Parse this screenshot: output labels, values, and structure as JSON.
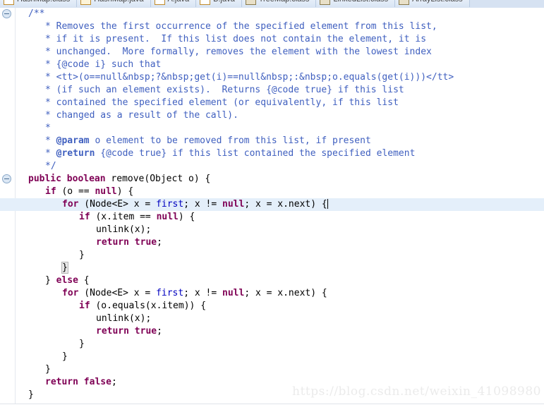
{
  "window": {
    "app": "Eclipse Java Editor",
    "watermark": "https://blog.csdn.net/weixin_41098980"
  },
  "tabbar": {
    "tabs": [
      {
        "label": "HashMap.class",
        "icon": "java-class-icon",
        "icon_kind": "doc",
        "active": false
      },
      {
        "label": "HashMap.java",
        "icon": "java-source-icon",
        "icon_kind": "docj",
        "active": false
      },
      {
        "label": "A.java",
        "icon": "java-source-icon",
        "icon_kind": "doc",
        "active": false
      },
      {
        "label": "B.java",
        "icon": "java-source-icon",
        "icon_kind": "doc",
        "active": false
      },
      {
        "label": "TreeMap.class",
        "icon": "java-jar-icon",
        "icon_kind": "jar",
        "active": false
      },
      {
        "label": "LinkedList.class",
        "icon": "java-jar-icon",
        "icon_kind": "jar",
        "active": true
      },
      {
        "label": "ArrayList.class",
        "icon": "java-jar-icon",
        "icon_kind": "jar",
        "active": false
      }
    ]
  },
  "editor": {
    "current_line_index": 15,
    "fold_marker_lines": [
      0,
      13
    ],
    "lines": [
      {
        "indent": 1,
        "tokens": [
          {
            "t": "cmt",
            "v": "/**"
          }
        ]
      },
      {
        "indent": 2,
        "tokens": [
          {
            "t": "cmt",
            "v": "* Removes the first occurrence of the specified element from this list,"
          }
        ]
      },
      {
        "indent": 2,
        "tokens": [
          {
            "t": "cmt",
            "v": "* if it is present.  If this list does not contain the element, it is"
          }
        ]
      },
      {
        "indent": 2,
        "tokens": [
          {
            "t": "cmt",
            "v": "* unchanged.  More formally, removes the element with the lowest index"
          }
        ]
      },
      {
        "indent": 2,
        "tokens": [
          {
            "t": "cmt",
            "v": "* {@code i} such that"
          }
        ]
      },
      {
        "indent": 2,
        "tokens": [
          {
            "t": "cmt",
            "v": "* <tt>(o==null&nbsp;?&nbsp;get(i)==null&nbsp;:&nbsp;o.equals(get(i)))</tt>"
          }
        ]
      },
      {
        "indent": 2,
        "tokens": [
          {
            "t": "cmt",
            "v": "* (if such an element exists).  Returns {@code true} if this list"
          }
        ]
      },
      {
        "indent": 2,
        "tokens": [
          {
            "t": "cmt",
            "v": "* contained the specified element (or equivalently, if this list"
          }
        ]
      },
      {
        "indent": 2,
        "tokens": [
          {
            "t": "cmt",
            "v": "* changed as a result of the call)."
          }
        ]
      },
      {
        "indent": 2,
        "tokens": [
          {
            "t": "cmt",
            "v": "*"
          }
        ]
      },
      {
        "indent": 2,
        "tokens": [
          {
            "t": "cmt",
            "v": "* "
          },
          {
            "t": "cmtag",
            "v": "@param"
          },
          {
            "t": "cmt",
            "v": " o element to be removed from this list, if present"
          }
        ]
      },
      {
        "indent": 2,
        "tokens": [
          {
            "t": "cmt",
            "v": "* "
          },
          {
            "t": "cmtag",
            "v": "@return"
          },
          {
            "t": "cmt",
            "v": " {@code true} if this list contained the specified element"
          }
        ]
      },
      {
        "indent": 2,
        "tokens": [
          {
            "t": "cmt",
            "v": "*/"
          }
        ]
      },
      {
        "indent": 1,
        "tokens": [
          {
            "t": "kw",
            "v": "public"
          },
          {
            "t": "pln",
            "v": " "
          },
          {
            "t": "kw",
            "v": "boolean"
          },
          {
            "t": "pln",
            "v": " remove(Object o) {"
          }
        ]
      },
      {
        "indent": 2,
        "tokens": [
          {
            "t": "kw",
            "v": "if"
          },
          {
            "t": "pln",
            "v": " (o == "
          },
          {
            "t": "kw",
            "v": "null"
          },
          {
            "t": "pln",
            "v": ") {"
          }
        ]
      },
      {
        "indent": 3,
        "tokens": [
          {
            "t": "kw",
            "v": "for"
          },
          {
            "t": "pln",
            "v": " (Node<E> x = "
          },
          {
            "t": "fld",
            "v": "first"
          },
          {
            "t": "pln",
            "v": "; x != "
          },
          {
            "t": "kw",
            "v": "null"
          },
          {
            "t": "pln",
            "v": "; x = x.next) {"
          },
          {
            "t": "caret",
            "v": ""
          }
        ]
      },
      {
        "indent": 4,
        "tokens": [
          {
            "t": "kw",
            "v": "if"
          },
          {
            "t": "pln",
            "v": " (x.item == "
          },
          {
            "t": "kw",
            "v": "null"
          },
          {
            "t": "pln",
            "v": ") {"
          }
        ]
      },
      {
        "indent": 5,
        "tokens": [
          {
            "t": "pln",
            "v": "unlink(x);"
          }
        ]
      },
      {
        "indent": 5,
        "tokens": [
          {
            "t": "kw",
            "v": "return"
          },
          {
            "t": "pln",
            "v": " "
          },
          {
            "t": "kw",
            "v": "true"
          },
          {
            "t": "pln",
            "v": ";"
          }
        ]
      },
      {
        "indent": 4,
        "tokens": [
          {
            "t": "pln",
            "v": "}"
          }
        ]
      },
      {
        "indent": 3,
        "tokens": [
          {
            "t": "match",
            "v": "}"
          }
        ]
      },
      {
        "indent": 2,
        "tokens": [
          {
            "t": "pln",
            "v": "} "
          },
          {
            "t": "kw",
            "v": "else"
          },
          {
            "t": "pln",
            "v": " {"
          }
        ]
      },
      {
        "indent": 3,
        "tokens": [
          {
            "t": "kw",
            "v": "for"
          },
          {
            "t": "pln",
            "v": " (Node<E> x = "
          },
          {
            "t": "fld",
            "v": "first"
          },
          {
            "t": "pln",
            "v": "; x != "
          },
          {
            "t": "kw",
            "v": "null"
          },
          {
            "t": "pln",
            "v": "; x = x.next) {"
          }
        ]
      },
      {
        "indent": 4,
        "tokens": [
          {
            "t": "kw",
            "v": "if"
          },
          {
            "t": "pln",
            "v": " (o.equals(x.item)) {"
          }
        ]
      },
      {
        "indent": 5,
        "tokens": [
          {
            "t": "pln",
            "v": "unlink(x);"
          }
        ]
      },
      {
        "indent": 5,
        "tokens": [
          {
            "t": "kw",
            "v": "return"
          },
          {
            "t": "pln",
            "v": " "
          },
          {
            "t": "kw",
            "v": "true"
          },
          {
            "t": "pln",
            "v": ";"
          }
        ]
      },
      {
        "indent": 4,
        "tokens": [
          {
            "t": "pln",
            "v": "}"
          }
        ]
      },
      {
        "indent": 3,
        "tokens": [
          {
            "t": "pln",
            "v": "}"
          }
        ]
      },
      {
        "indent": 2,
        "tokens": [
          {
            "t": "pln",
            "v": "}"
          }
        ]
      },
      {
        "indent": 2,
        "tokens": [
          {
            "t": "kw",
            "v": "return"
          },
          {
            "t": "pln",
            "v": " "
          },
          {
            "t": "kw",
            "v": "false"
          },
          {
            "t": "pln",
            "v": ";"
          }
        ]
      },
      {
        "indent": 1,
        "tokens": [
          {
            "t": "pln",
            "v": "}"
          }
        ]
      }
    ]
  },
  "colors": {
    "comment": "#3f5fbf",
    "keyword": "#7f0055",
    "field": "#0000c0",
    "plain": "#000000",
    "current_line_bg": "#e4effa",
    "tab_bar_bg": "#d6e2f2",
    "watermark": "#ebebeb"
  }
}
